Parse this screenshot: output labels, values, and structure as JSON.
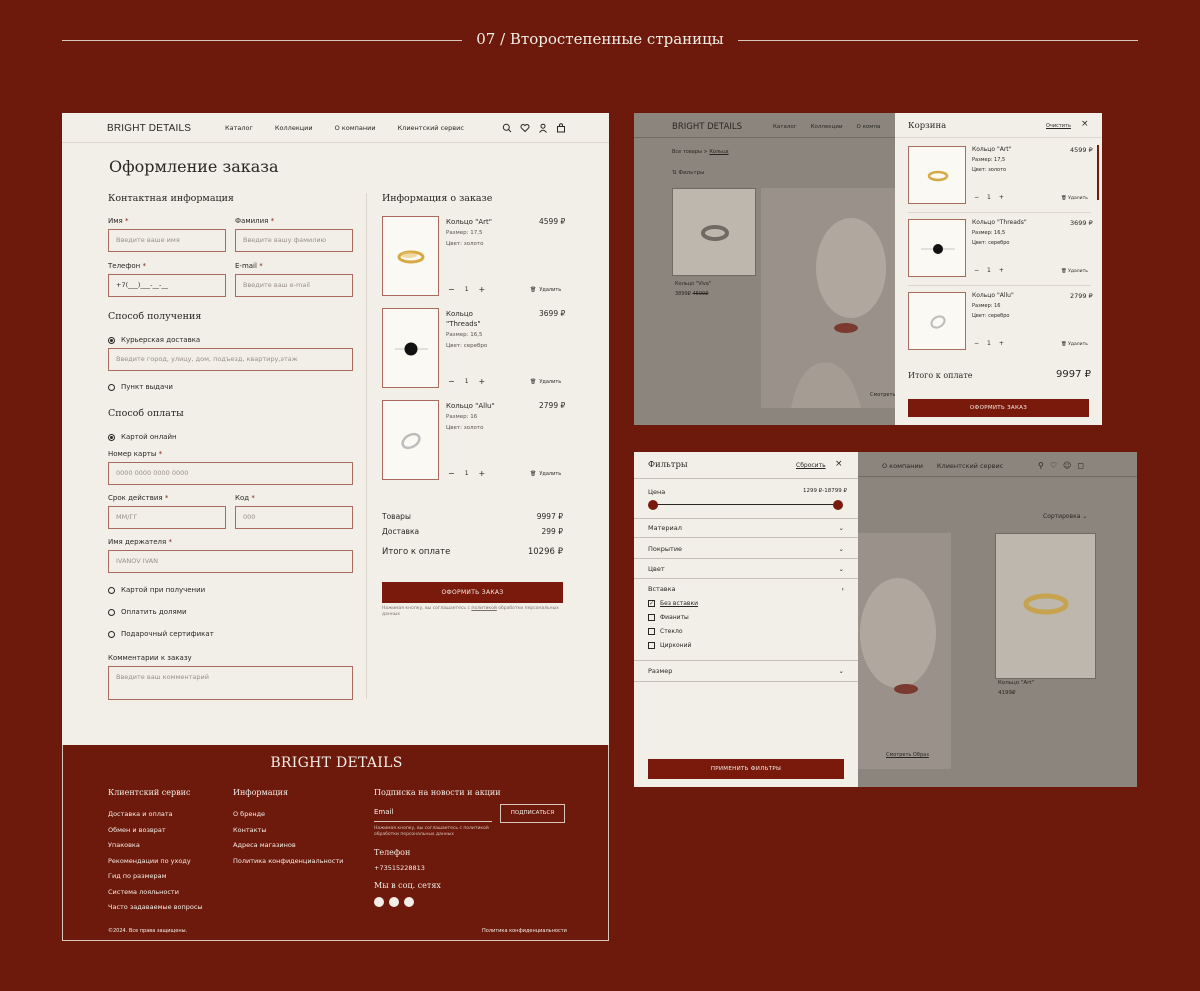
{
  "header": {
    "title": "07 / Второстепенные страницы"
  },
  "checkout": {
    "logo": "BRIGHT DETAILS",
    "nav": [
      "Каталог",
      "Коллекции",
      "О компании",
      "Клиентский сервис"
    ],
    "title": "Оформление заказа",
    "contact_title": "Контактная информация",
    "name_label": "Имя",
    "name_ph": "Введите ваше имя",
    "surname_label": "Фамилия",
    "surname_ph": "Введите вашу фамилию",
    "phone_label": "Телефон",
    "phone_value": "+7(___)___-__-__",
    "email_label": "E-mail",
    "email_ph": "Введите ваш e-mail",
    "delivery_title": "Способ получения",
    "courier": "Курьерская доставка",
    "address_ph": "Введите город, улицу, дом, подъезд, квартиру,этаж",
    "pickup": "Пункт выдачи",
    "payment_title": "Способ оплаты",
    "card_online": "Картой онлайн",
    "card_label": "Номер карты",
    "card_ph": "0000 0000 0000 0000",
    "expiry_label": "Срок действия",
    "expiry_ph": "ММ/ГГ",
    "code_label": "Код",
    "code_ph": "000",
    "holder_label": "Имя держателя",
    "holder_ph": "IVANOV IVAN",
    "pay_on_receipt": "Картой при получении",
    "pay_parts": "Оплатить долями",
    "gift_cert": "Подарочный сертификат",
    "comment_label": "Комментарии к заказу",
    "comment_ph": "Введите ваш комментарий",
    "order_title": "Информация о заказе",
    "items": [
      {
        "name": "Кольцо \"Art\"",
        "size": "Размер: 17,5",
        "color": "Цвет: золото",
        "price": "4599 ₽",
        "qty": "1"
      },
      {
        "name": "Кольцо \"Threads\"",
        "size": "Размер: 16,5",
        "color": "Цвет: серебро",
        "price": "3699 ₽",
        "qty": "1"
      },
      {
        "name": "Кольцо \"Allu\"",
        "size": "Размер: 16",
        "color": "Цвет: золото",
        "price": "2799 ₽",
        "qty": "1"
      }
    ],
    "delete_label": "Удалить",
    "goods_label": "Товары",
    "goods_value": "9997 ₽",
    "shipping_label": "Доставка",
    "shipping_value": "299 ₽",
    "total_label": "Итого к оплате",
    "total_value": "10296 ₽",
    "submit": "ОФОРМИТЬ ЗАКАЗ",
    "consent_1": "Нажимая кнопку, вы соглашаетесь с",
    "consent_link": "политикой",
    "consent_2": "обработки персональных данных"
  },
  "footer": {
    "logo": "BRIGHT DETAILS",
    "col1_title": "Клиентский сервис",
    "col1": [
      "Доставка и оплата",
      "Обмен и возврат",
      "Упаковка",
      "Рекомендации по уходу",
      "Гид по размерам",
      "Система лояльности",
      "Часто задаваемые вопросы"
    ],
    "col2_title": "Информация",
    "col2": [
      "О бренде",
      "Контакты",
      "Адреса магазинов",
      "Политика конфиденциальности"
    ],
    "news_title": "Подписка на новости и акции",
    "email_ph": "Email",
    "subscribe": "ПОДПИСАТЬСЯ",
    "consent": "Нажимая кнопку, вы соглашаетесь с политикой обработки персональных данных",
    "phone_title": "Телефон",
    "phone": "+73515228813",
    "social_title": "Мы в соц. сетях",
    "copyright": "©2024. Все права защищены.",
    "privacy": "Политика конфиденциальности"
  },
  "cart": {
    "logo": "BRIGHT DETAILS",
    "nav": [
      "Каталог",
      "Коллекции",
      "О компа"
    ],
    "breadcrumb_home": "Все товары",
    "breadcrumb_current": "Кольца",
    "filters_label": "Фильтры",
    "bg_product": "Кольцо \"Viva\"",
    "bg_price": "3899₽",
    "bg_old_price": "4599₽",
    "bg_look": "Смотреть",
    "title": "Корзина",
    "clear": "Очистить",
    "items": [
      {
        "name": "Кольцо \"Art\"",
        "size": "Размер: 17,5",
        "color": "Цвет: золото",
        "price": "4599 ₽",
        "qty": "1"
      },
      {
        "name": "Кольцо \"Threads\"",
        "size": "Размер: 16,5",
        "color": "Цвет: серебро",
        "price": "3699 ₽",
        "qty": "1"
      },
      {
        "name": "Кольцо \"Allu\"",
        "size": "Размер: 16",
        "color": "Цвет: серебро",
        "price": "2799 ₽",
        "qty": "1"
      }
    ],
    "delete_label": "Удалить",
    "total_label": "Итого к оплате",
    "total_value": "9997 ₽",
    "checkout": "ОФОРМИТЬ ЗАКАЗ"
  },
  "filters": {
    "title": "Фильтры",
    "reset": "Сбросить",
    "price_label": "Цена",
    "price_range": "1299 ₽-18799 ₽",
    "price_range_fraction": [
      0,
      1
    ],
    "sections": [
      "Материал",
      "Покрытие",
      "Цвет"
    ],
    "insert_title": "Вставка",
    "inserts": [
      {
        "label": "Без вставки",
        "checked": true
      },
      {
        "label": "Фианиты",
        "checked": false
      },
      {
        "label": "Стекло",
        "checked": false
      },
      {
        "label": "Цирконий",
        "checked": false
      }
    ],
    "size_title": "Размер",
    "apply": "ПРИМЕНИТЬ ФИЛЬТРЫ",
    "bg_nav": [
      "О компании",
      "Клиентский сервис"
    ],
    "bg_sort": "Сортировка",
    "bg_product": "Кольцо \"Art\"",
    "bg_price": "4199₽",
    "bg_look": "Смотреть Образ"
  }
}
